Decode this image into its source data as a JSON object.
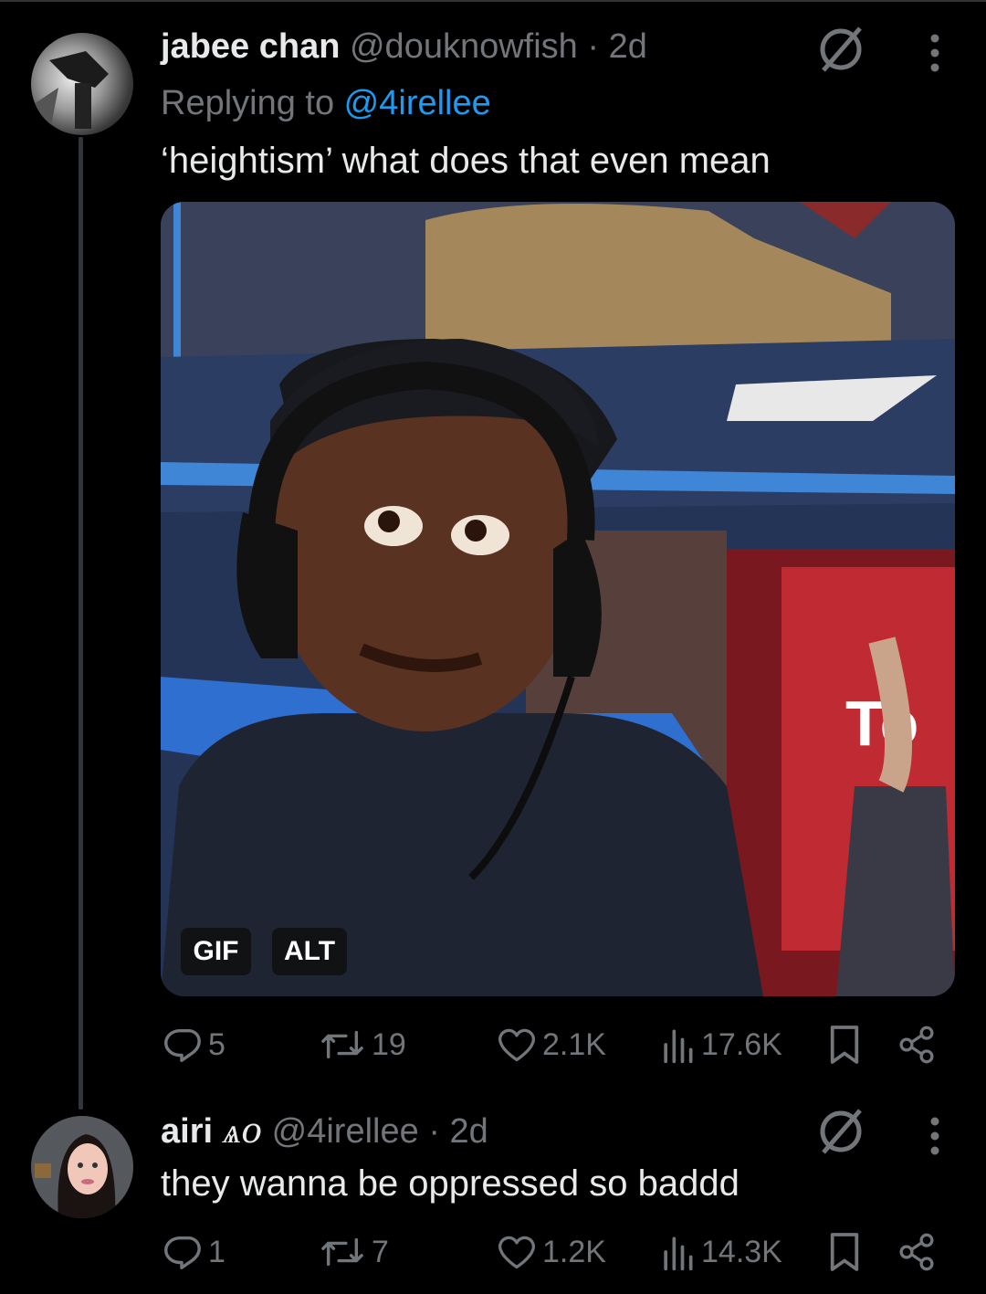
{
  "posts": [
    {
      "display_name": "jabee chan",
      "handle": "@douknowfish",
      "time": "· 2d",
      "replying_prefix": "Replying to ",
      "replying_to": "@4irellee",
      "text": "‘heightism’ what does that even mean",
      "media": {
        "gif_badge": "GIF",
        "alt_badge": "ALT",
        "overlay_text": "To"
      },
      "stats": {
        "replies": "5",
        "reposts": "19",
        "likes": "2.1K",
        "views": "17.6K"
      }
    },
    {
      "display_name": "airi 𝓐𝓷",
      "display_name_glyphs": "ѧο",
      "handle": "@4irellee",
      "time": "· 2d",
      "text": "they wanna be oppressed so baddd",
      "stats": {
        "replies": "1",
        "reposts": "7",
        "likes": "1.2K",
        "views": "14.3K"
      }
    }
  ],
  "icons": [
    "grok-icon",
    "more-icon",
    "reply-icon",
    "repost-icon",
    "like-icon",
    "views-icon",
    "bookmark-icon",
    "share-icon"
  ],
  "colors": {
    "background": "#000000",
    "text": "#e7e9ea",
    "muted": "#71767b",
    "link": "#1d9bf0"
  }
}
